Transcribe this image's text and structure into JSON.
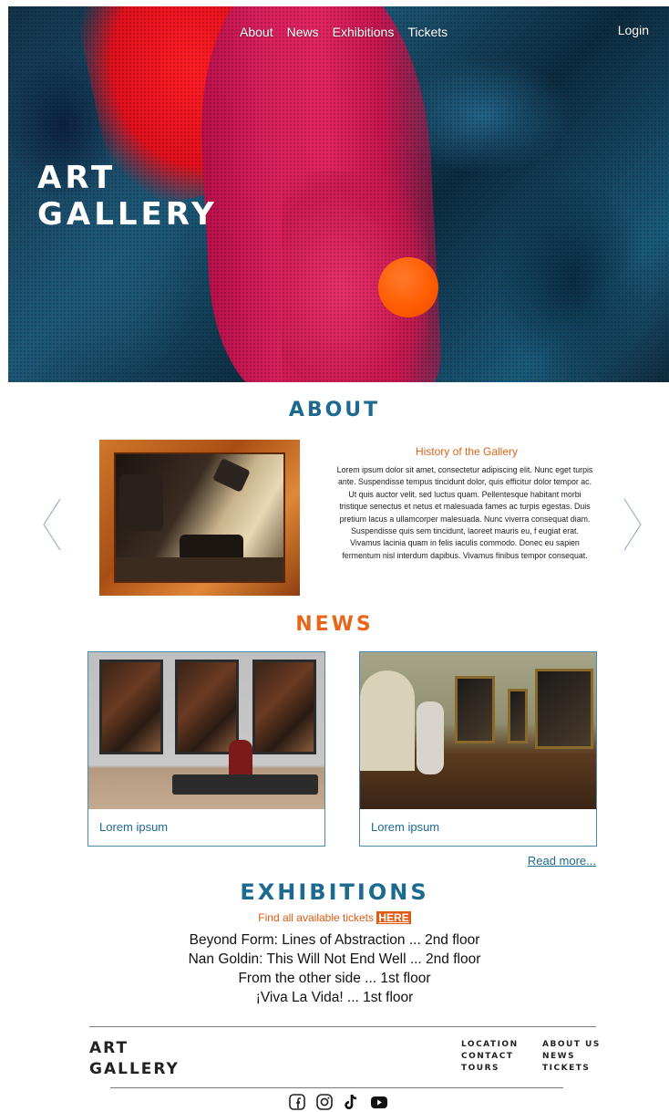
{
  "nav": {
    "items": [
      "About",
      "News",
      "Exhibitions",
      "Tickets"
    ],
    "login": "Login"
  },
  "hero": {
    "title_line1": "ART",
    "title_line2": "GALLERY"
  },
  "about": {
    "title": "ABOUT",
    "history_title": "History of the Gallery",
    "history_text": "Lorem ipsum dolor sit amet, consectetur adipiscing elit. Nunc eget turpis ante. Suspendisse tempus tincidunt dolor, quis efficitur dolor tempor ac. Ut quis auctor velit, sed luctus quam. Pellentesque habitant morbi tristique senectus et netus et malesuada fames ac turpis egestas. Duis pretium lacus a ullamcorper malesuada. Nunc viverra consequat diam. Suspendisse quis sem tincidunt, laoreet mauris eu, f eugiat erat. Vivamus lacinia quam in felis iaculis commodo. Donec eu sapien fermentum nisl interdum dapibus. Vivamus finibus tempor consequat."
  },
  "news": {
    "title": "NEWS",
    "cards": [
      {
        "caption": "Lorem ipsum"
      },
      {
        "caption": "Lorem ipsum"
      }
    ],
    "read_more": "Read more..."
  },
  "exhibitions": {
    "title": "EXHIBITIONS",
    "tickets_text": "Find all available tickets",
    "tickets_link": "HERE",
    "items": [
      "Beyond Form: Lines of Abstraction ... 2nd floor",
      "Nan Goldin: This Will Not End Well ... 2nd floor",
      "From the other side ... 1st floor",
      "¡Viva La Vida! ... 1st floor"
    ]
  },
  "footer": {
    "logo_line1": "ART",
    "logo_line2": "GALLERY",
    "col1": [
      "LOCATION",
      "CONTACT",
      "TOURS"
    ],
    "col2": [
      "ABOUT US",
      "NEWS",
      "TICKETS"
    ],
    "social_icons": [
      "facebook-icon",
      "instagram-icon",
      "tiktok-icon",
      "youtube-icon"
    ]
  },
  "colors": {
    "blue_accent": "#1d6a8f",
    "orange_accent": "#e8661c"
  }
}
